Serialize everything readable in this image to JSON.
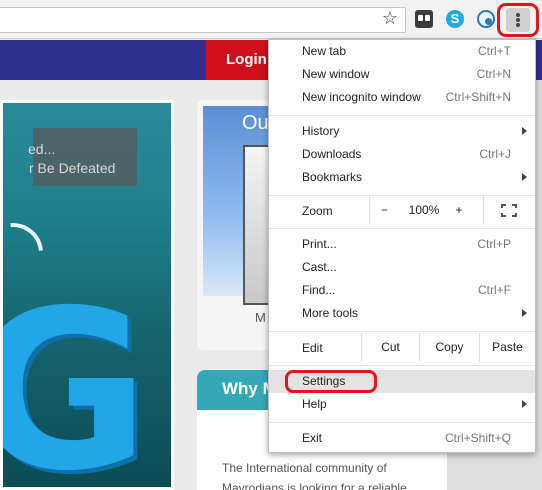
{
  "browser": {
    "icons": [
      "star-icon",
      "extension-icon",
      "skype-icon",
      "extension-phone-icon",
      "kebab-menu-icon"
    ],
    "highlight_color": "#e8141c"
  },
  "site": {
    "login_label": "Login",
    "hero_line1": "ed...",
    "hero_line2": "r Be Defeated",
    "hero_letter": "G",
    "side_card_title": "Ou",
    "side_card_sub": "M",
    "why_title": "Why M",
    "why_text": "The International community of Mavrodians is looking for a reliable,",
    "colors": {
      "nav": "#2e2f8f",
      "login": "#cf101a",
      "teal": "#35a8b8"
    }
  },
  "menu": {
    "new_tab": {
      "label": "New tab",
      "shortcut": "Ctrl+T"
    },
    "new_window": {
      "label": "New window",
      "shortcut": "Ctrl+N"
    },
    "new_incognito": {
      "label": "New incognito window",
      "shortcut": "Ctrl+Shift+N"
    },
    "history": {
      "label": "History"
    },
    "downloads": {
      "label": "Downloads",
      "shortcut": "Ctrl+J"
    },
    "bookmarks": {
      "label": "Bookmarks"
    },
    "zoom": {
      "label": "Zoom",
      "minus": "−",
      "value": "100%",
      "plus": "+"
    },
    "print": {
      "label": "Print...",
      "shortcut": "Ctrl+P"
    },
    "cast": {
      "label": "Cast..."
    },
    "find": {
      "label": "Find...",
      "shortcut": "Ctrl+F"
    },
    "more_tools": {
      "label": "More tools"
    },
    "edit": {
      "label": "Edit",
      "cut": "Cut",
      "copy": "Copy",
      "paste": "Paste"
    },
    "settings": {
      "label": "Settings"
    },
    "help": {
      "label": "Help"
    },
    "exit": {
      "label": "Exit",
      "shortcut": "Ctrl+Shift+Q"
    }
  }
}
